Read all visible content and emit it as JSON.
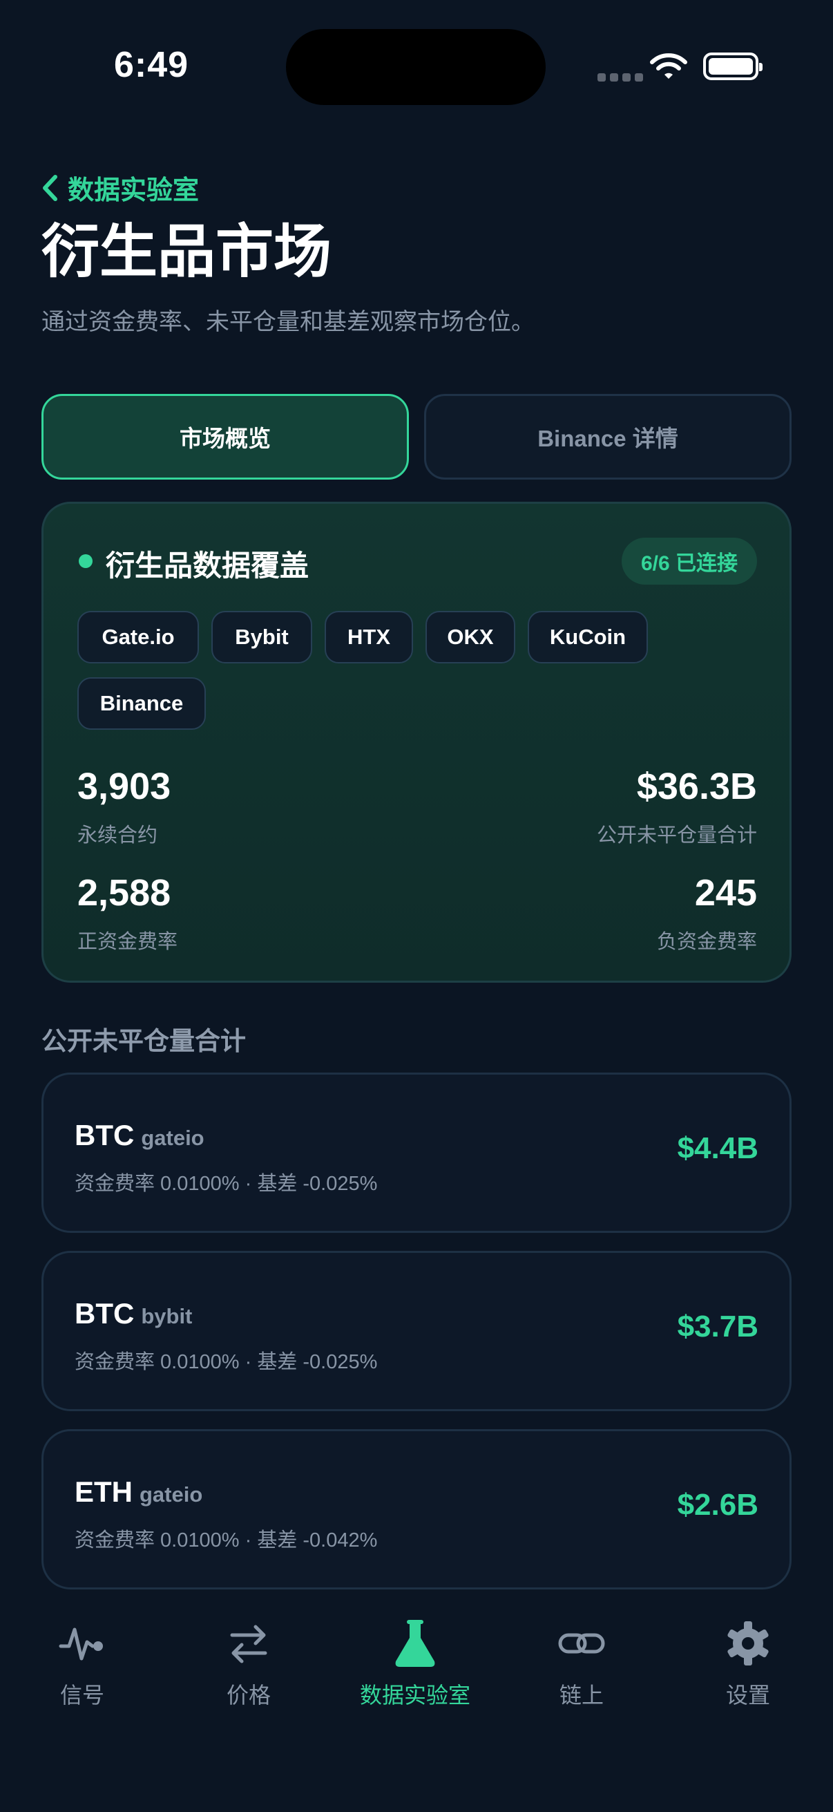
{
  "status_bar": {
    "time": "6:49"
  },
  "header": {
    "back_label": "数据实验室",
    "title": "衍生品市场",
    "subtitle": "通过资金费率、未平仓量和基差观察市场仓位。"
  },
  "tabs": [
    {
      "label": "市场概览",
      "active": true
    },
    {
      "label": "Binance 详情",
      "active": false
    }
  ],
  "coverage": {
    "title": "衍生品数据覆盖",
    "connected": "6/6 已连接",
    "exchanges": [
      "Gate.io",
      "Bybit",
      "HTX",
      "OKX",
      "KuCoin",
      "Binance"
    ],
    "stats": {
      "perpetuals": {
        "value": "3,903",
        "label": "永续合约"
      },
      "open_interest": {
        "value": "$36.3B",
        "label": "公开未平仓量合计"
      },
      "positive_funding": {
        "value": "2,588",
        "label": "正资金费率"
      },
      "negative_funding": {
        "value": "245",
        "label": "负资金费率"
      }
    }
  },
  "oi_section": {
    "title": "公开未平仓量合计",
    "rows": [
      {
        "symbol": "BTC",
        "exchange": "gateio",
        "meta": "资金费率 0.0100% · 基差 -0.025%",
        "value": "$4.4B"
      },
      {
        "symbol": "BTC",
        "exchange": "bybit",
        "meta": "资金费率 0.0100% · 基差 -0.025%",
        "value": "$3.7B"
      },
      {
        "symbol": "ETH",
        "exchange": "gateio",
        "meta": "资金费率 0.0100% · 基差 -0.042%",
        "value": "$2.6B"
      }
    ]
  },
  "nav": [
    {
      "label": "信号",
      "icon": "pulse-icon",
      "active": false
    },
    {
      "label": "价格",
      "icon": "swap-arrows-icon",
      "active": false
    },
    {
      "label": "数据实验室",
      "icon": "flask-icon",
      "active": true
    },
    {
      "label": "链上",
      "icon": "link-icon",
      "active": false
    },
    {
      "label": "设置",
      "icon": "gear-icon",
      "active": false
    }
  ],
  "colors": {
    "accent": "#34d69a",
    "background": "#0b1523",
    "muted": "#8895a6"
  }
}
